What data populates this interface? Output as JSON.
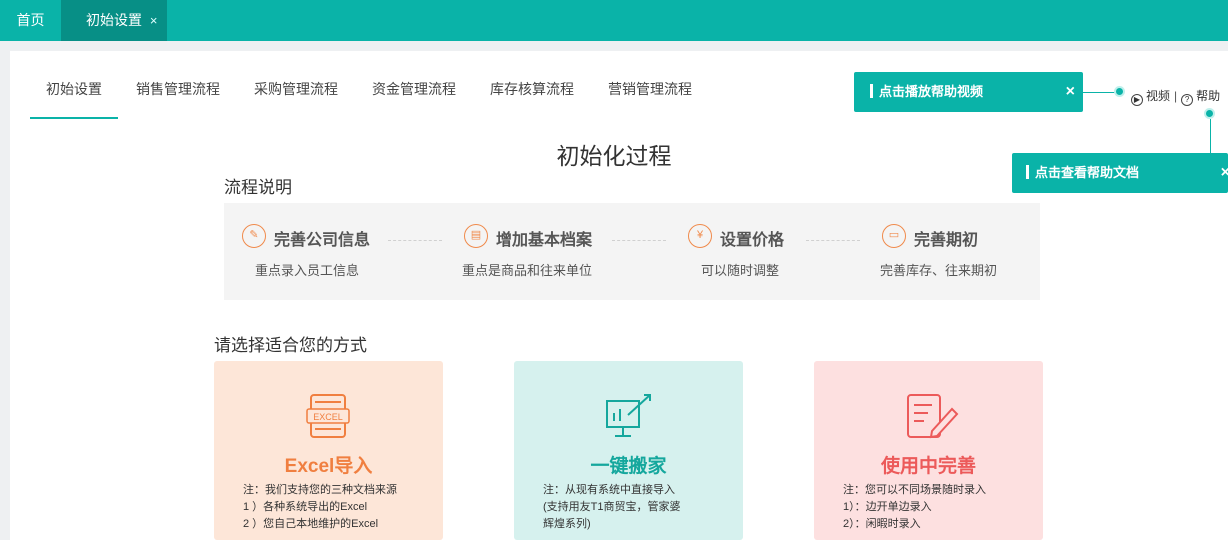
{
  "top_tabs": [
    {
      "label": "首页"
    },
    {
      "label": "初始设置",
      "close": "×"
    }
  ],
  "sub_nav": [
    "初始设置",
    "销售管理流程",
    "采购管理流程",
    "资金管理流程",
    "库存核算流程",
    "营销管理流程"
  ],
  "help": {
    "video_label": "视频",
    "divider": "|",
    "help_label": "帮助",
    "video_tip": "点击播放帮助视频",
    "doc_tip": "点击查看帮助文档",
    "close": "×"
  },
  "main_title": "初始化过程",
  "flow_title": "流程说明",
  "steps": [
    {
      "name": "完善公司信息",
      "desc": "重点录入员工信息",
      "icon": "edit-icon"
    },
    {
      "name": "增加基本档案",
      "desc": "重点是商品和往来单位",
      "icon": "document-icon"
    },
    {
      "name": "设置价格",
      "desc": "可以随时调整",
      "icon": "yen-icon"
    },
    {
      "name": "完善期初",
      "desc": "完善库存、往来期初",
      "icon": "monitor-icon"
    }
  ],
  "choose_title": "请选择适合您的方式",
  "cards": [
    {
      "title": "Excel导入",
      "icon_text": "EXCEL",
      "lines": [
        "注：我们支持您的三种文档来源",
        "1 ）各种系统导出的Excel",
        "2 ）您自己本地维护的Excel"
      ]
    },
    {
      "title": "一键搬家",
      "lines": [
        "注：从现有系统中直接导入",
        "(支持用友T1商贸宝，管家婆",
        "辉煌系列)"
      ]
    },
    {
      "title": "使用中完善",
      "lines": [
        "注：您可以不同场景随时录入",
        "1）：边开单边录入",
        "2）：闲暇时录入"
      ]
    }
  ],
  "colors": {
    "accent": "#0ab3a8",
    "excel": "#f07f40",
    "move": "#15a79d",
    "use": "#ec5a5a"
  }
}
